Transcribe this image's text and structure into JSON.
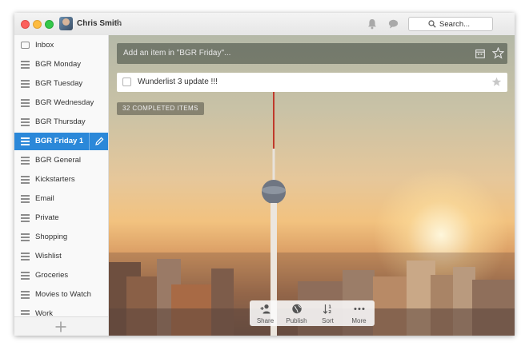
{
  "window": {
    "user_name": "Chris Smith",
    "search_placeholder": "Search..."
  },
  "sidebar": {
    "items": [
      {
        "label": "Inbox",
        "icon": "inbox-icon"
      },
      {
        "label": "BGR Monday",
        "icon": "list-icon"
      },
      {
        "label": "BGR Tuesday",
        "icon": "list-icon"
      },
      {
        "label": "BGR Wednesday",
        "icon": "list-icon"
      },
      {
        "label": "BGR Thursday",
        "icon": "list-icon"
      },
      {
        "label": "BGR Friday",
        "icon": "list-icon",
        "count": "1",
        "active": true
      },
      {
        "label": "BGR General",
        "icon": "list-icon"
      },
      {
        "label": "Kickstarters",
        "icon": "list-icon"
      },
      {
        "label": "Email",
        "icon": "list-icon"
      },
      {
        "label": "Private",
        "icon": "list-icon"
      },
      {
        "label": "Shopping",
        "icon": "list-icon"
      },
      {
        "label": "Wishlist",
        "icon": "list-icon"
      },
      {
        "label": "Groceries",
        "icon": "list-icon"
      },
      {
        "label": "Movies to Watch",
        "icon": "list-icon"
      },
      {
        "label": "Work",
        "icon": "list-icon"
      }
    ]
  },
  "main": {
    "add_placeholder": "Add an item in \"BGR Friday\"...",
    "tasks": [
      {
        "title": "Wunderlist 3 update !!!",
        "completed": false,
        "starred": false
      }
    ],
    "completed_label": "32 COMPLETED ITEMS",
    "actions": [
      {
        "label": "Share",
        "icon": "add-person-icon"
      },
      {
        "label": "Publish",
        "icon": "globe-icon"
      },
      {
        "label": "Sort",
        "icon": "sort-icon"
      },
      {
        "label": "More",
        "icon": "more-dots-icon"
      }
    ]
  },
  "colors": {
    "accent": "#2b88d9",
    "sidebar_bg": "#f9f9f9"
  }
}
